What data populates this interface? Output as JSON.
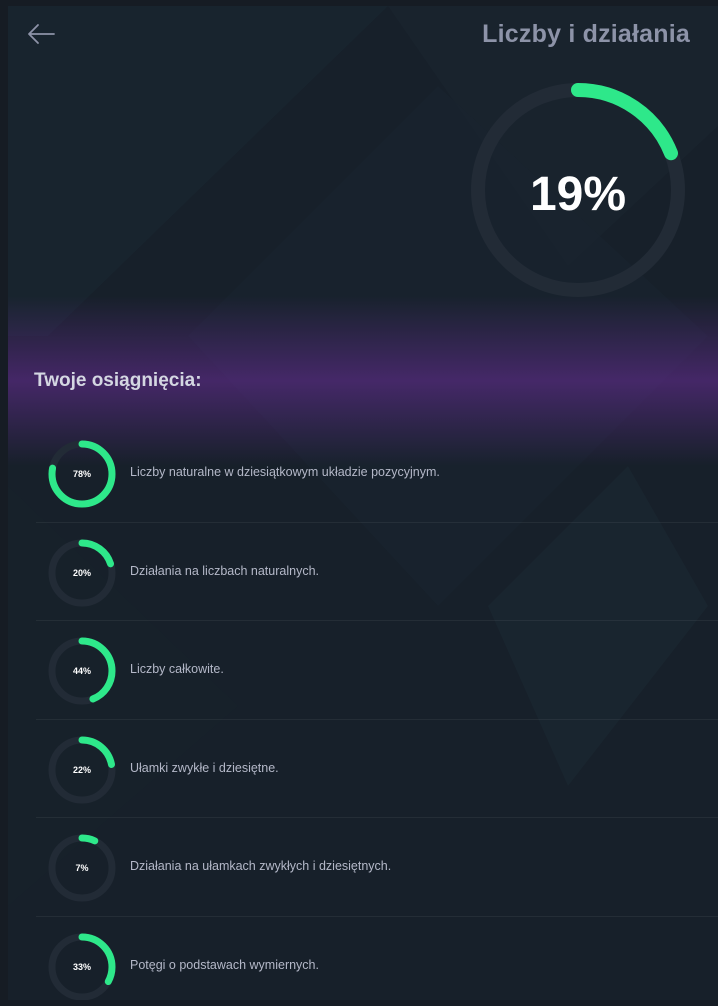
{
  "header": {
    "title": "Liczby i działania",
    "back_icon": "arrow-left-icon"
  },
  "overall": {
    "progress_label": "19%",
    "progress": 19
  },
  "achievements": {
    "heading": "Twoje osiągnięcia:",
    "items": [
      {
        "percent_label": "78%",
        "progress": 78,
        "label": "Liczby naturalne w dziesiątkowym układzie pozycyjnym."
      },
      {
        "percent_label": "20%",
        "progress": 20,
        "label": "Działania na liczbach naturalnych."
      },
      {
        "percent_label": "44%",
        "progress": 44,
        "label": "Liczby całkowite."
      },
      {
        "percent_label": "22%",
        "progress": 22,
        "label": "Ułamki zwykłe i dziesiętne."
      },
      {
        "percent_label": "7%",
        "progress": 7,
        "label": "Działania na ułamkach zwykłych i dziesiętnych."
      },
      {
        "percent_label": "33%",
        "progress": 33,
        "label": "Potęgi o podstawach wymiernych."
      }
    ]
  },
  "colors": {
    "accent": "#2ee88a",
    "background": "#17202a",
    "title": "#8d93a8",
    "track": "#222b36",
    "glow": "#6a2d99"
  }
}
